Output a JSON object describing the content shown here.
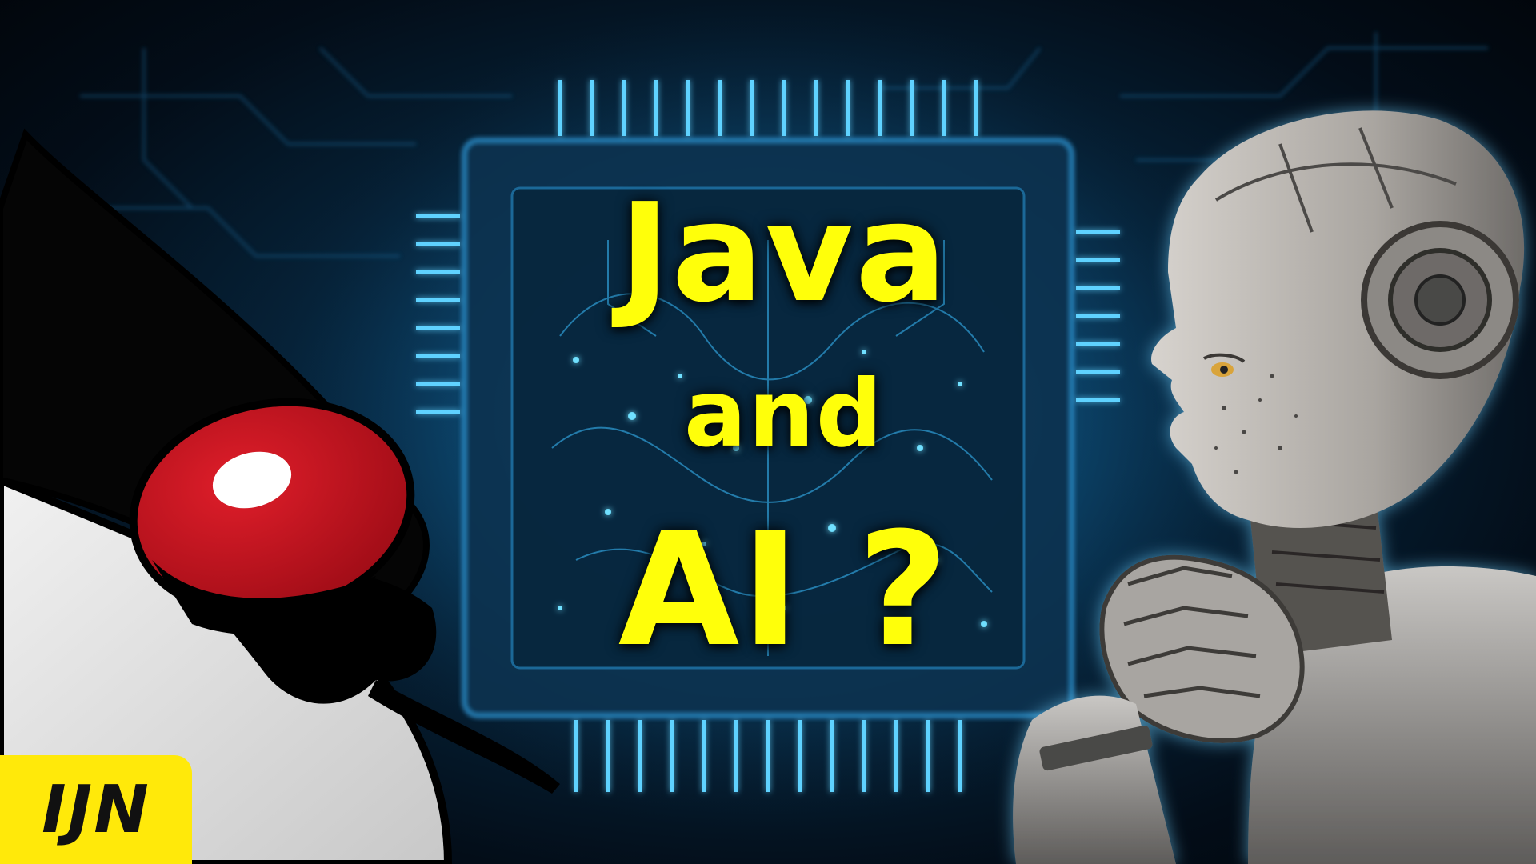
{
  "headline": {
    "line1": "Java",
    "line2": "and",
    "line3": "AI ?"
  },
  "badge": {
    "label": "IJN"
  },
  "colors": {
    "headline": "#ffff0a",
    "badge_bg": "#ffe90a",
    "circuit_glow": "#35b6ff",
    "duke_nose": "#c4101c"
  },
  "illustrations": {
    "background": "circuit-board-chip-illustration",
    "left": "java-duke-mascot-illustration",
    "right": "thinking-robot-illustration"
  }
}
